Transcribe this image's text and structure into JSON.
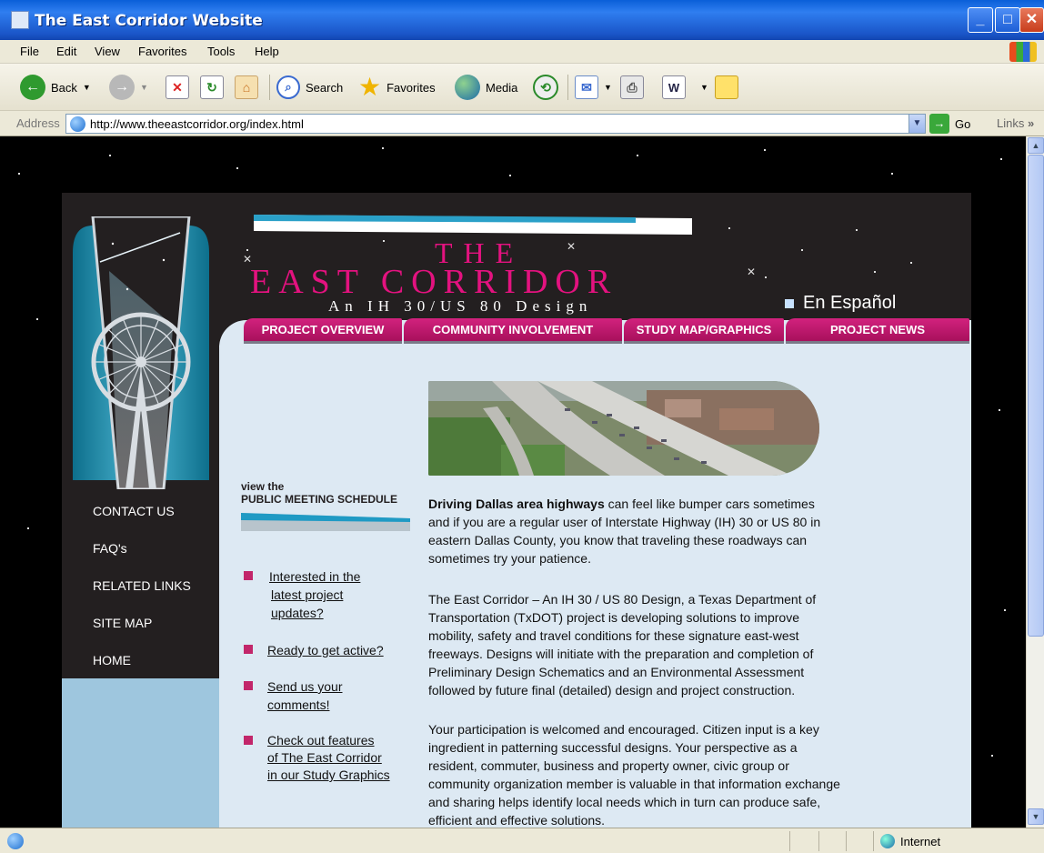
{
  "window": {
    "title": "The East Corridor Website"
  },
  "menu": [
    "File",
    "Edit",
    "View",
    "Favorites",
    "Tools",
    "Help"
  ],
  "toolbar": {
    "back": "Back",
    "search": "Search",
    "favorites": "Favorites",
    "media": "Media"
  },
  "address": {
    "label": "Address",
    "url": "http://www.theeastcorridor.org/index.html",
    "go": "Go",
    "links": "Links"
  },
  "status": {
    "zone": "Internet"
  },
  "site": {
    "heading_the": "THE",
    "heading_main": "EAST CORRIDOR",
    "heading_sub": "An IH 30/US 80 Design",
    "espanol": "En Español",
    "tabs": [
      "PROJECT OVERVIEW",
      "COMMUNITY INVOLVEMENT",
      "STUDY MAP/GRAPHICS",
      "PROJECT NEWS"
    ],
    "left_nav": [
      "CONTACT US",
      "FAQ's",
      "RELATED LINKS",
      "SITE MAP",
      "HOME"
    ],
    "meeting": {
      "view": "view the",
      "schedule": "PUBLIC MEETING SCHEDULE"
    },
    "quick_links": [
      [
        "Interested in the",
        "latest project",
        "updates?"
      ],
      [
        "Ready to get active?"
      ],
      [
        "Send us your",
        "comments!"
      ],
      [
        "Check out features",
        "of The East Corridor",
        "in our Study Graphics"
      ]
    ],
    "intro_bold": "Driving Dallas area highways",
    "intro_rest": " can feel like bumper cars sometimes",
    "p1_lines": [
      "and if you are a regular user of Interstate Highway (IH) 30 or US 80 in",
      "eastern Dallas County, you know that traveling these roadways can",
      "sometimes try your patience."
    ],
    "p2_lines": [
      "The East Corridor – An IH 30 / US 80 Design, a Texas Department of",
      "Transportation (TxDOT) project is developing solutions to improve",
      "mobility, safety and travel conditions for these signature east-west",
      "freeways. Designs will initiate with the preparation and completion of",
      "Preliminary Design Schematics and an Environmental Assessment",
      "followed by future final (detailed) design and project construction."
    ],
    "p3_lines": [
      "Your participation is welcomed and encouraged. Citizen input is a key",
      "ingredient in patterning successful designs. Your perspective as a",
      "resident, commuter, business and property owner, civic group or",
      "community organization member is valuable in that information exchange",
      "and sharing helps identify local needs which in turn can produce safe,",
      "efficient and effective solutions."
    ]
  },
  "colors": {
    "brand_pink": "#e3127f",
    "tab_pink": "#c2185b",
    "content_bg": "#dde9f3",
    "sidebar_dark": "#231f20",
    "sidebar_light": "#9ec6de"
  }
}
